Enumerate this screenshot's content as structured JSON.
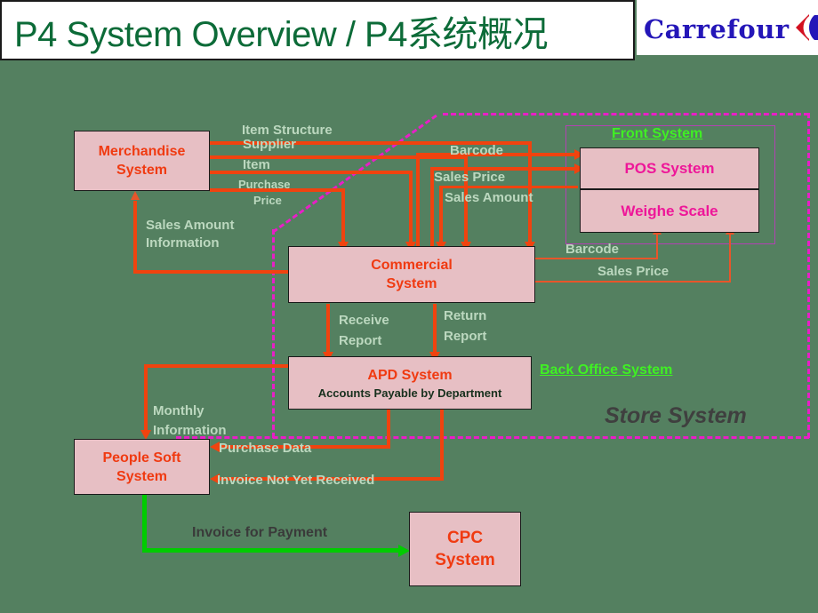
{
  "header": {
    "title_en": "P4 System Overview / P4",
    "title_cn": "系统概况",
    "brand": "Carrefour",
    "brand_color": "#2416b8",
    "title_color": "#0c6b38"
  },
  "canvas": {
    "background_color": "#548060",
    "box_fill": "#e7bfc4",
    "box_text_color": "#f03a11",
    "connector_color": "#f0430f",
    "boundary_color": "#e81ec7",
    "green_arrow_color": "#00cc00",
    "group_label_color": "#3ff023"
  },
  "systems": [
    {
      "id": "merchandise",
      "title": "Merchandise",
      "title2": "System",
      "subtitle": ""
    },
    {
      "id": "commercial",
      "title": "Commercial",
      "title2": "System",
      "subtitle": ""
    },
    {
      "id": "apd",
      "title": "APD  System",
      "title2": "",
      "subtitle": "Accounts  Payable  by  Department"
    },
    {
      "id": "peoplesoft",
      "title": "People  Soft",
      "title2": "System",
      "subtitle": ""
    },
    {
      "id": "cpc",
      "title": "CPC",
      "title2": "System",
      "subtitle": ""
    },
    {
      "id": "pos",
      "title": "POS System",
      "title2": "",
      "subtitle": ""
    },
    {
      "id": "weighe",
      "title": "Weighe  Scale",
      "title2": "",
      "subtitle": ""
    }
  ],
  "groups": {
    "front_system": "Front System",
    "back_office_system": "Back Office System",
    "store_system": "Store System"
  },
  "flows": {
    "item_structure": "Item Structure",
    "supplier": "Supplier",
    "item": "Item",
    "purchase": "Purchase",
    "price": "Price",
    "sales_amount_information_1": "Sales Amount",
    "sales_amount_information_2": "Information",
    "barcode_top": "Barcode",
    "sales_price_top": "Sales Price",
    "sales_amount_top": "Sales Amount",
    "barcode_bottom": "Barcode",
    "sales_price_bottom": "Sales Price",
    "receive_1": "Receive",
    "receive_2": "Report",
    "return_1": "Return",
    "return_2": "Report",
    "monthly_1": "Monthly",
    "monthly_2": "Information",
    "purchase_data": "Purchase Data",
    "invoice_not_received": "Invoice Not Yet Received",
    "invoice_for_payment": "Invoice  for Payment"
  }
}
